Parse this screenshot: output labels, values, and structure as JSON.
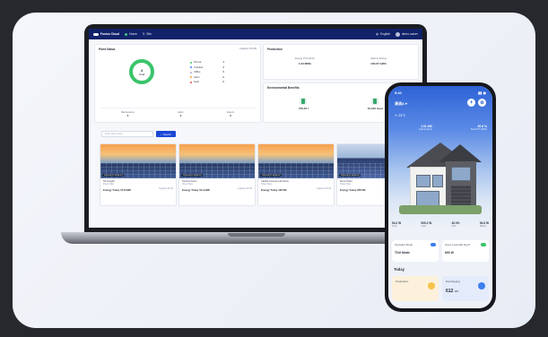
{
  "web": {
    "app_name": "Fusion Cloud",
    "nav": [
      "Home",
      "Site"
    ],
    "lang": "English",
    "user": "demo.owner",
    "plant_status": {
      "title": "Plant Status",
      "capacity": "Capacity: 80 kW",
      "ring_count": "4",
      "ring_label": "Total",
      "legend": [
        {
          "label": "Normal",
          "value": "4",
          "color": "#39c46b"
        },
        {
          "label": "Unlinked",
          "value": "0",
          "color": "#3d7ef0"
        },
        {
          "label": "Offline",
          "value": "0",
          "color": "#a8b0c0"
        },
        {
          "label": "Alarm",
          "value": "0",
          "color": "#f0a030"
        },
        {
          "label": "Fault",
          "value": "0",
          "color": "#e04a4a"
        }
      ],
      "stats": [
        {
          "label": "Maintenance",
          "value": "0"
        },
        {
          "label": "Alarm",
          "value": "0"
        },
        {
          "label": "Events",
          "value": "0"
        }
      ]
    },
    "production": {
      "title": "Production",
      "items": [
        {
          "label": "Energy This Month",
          "value": "1.03 MWh"
        },
        {
          "label": "Lifetime Energy",
          "value": "100.07 GWh"
        }
      ]
    },
    "env": {
      "title": "Environmental Benefits",
      "items": [
        {
          "value": "753.25 t"
        },
        {
          "value": "10,162 trees"
        }
      ]
    },
    "search_placeholder": "Enter plant name",
    "search_btn": "Search",
    "tiles": [
      {
        "badge": "2024-08-27 08:49:20",
        "name": "SK Sungkil",
        "row": "Power Rate",
        "energy": "Energy Today 15.8 kWh",
        "cap": "Capacity 20 kW",
        "img": "a"
      },
      {
        "badge": "2024-08-27 08:49:20",
        "name": "Sunrise Demo",
        "row": "Power Rate",
        "energy": "Energy Today 16.0 kWh",
        "cap": "Capacity 20 kW",
        "img": "a"
      },
      {
        "badge": "2024-08-27 08:49:20",
        "name": "Capital Cosmos Lab Demo",
        "row": "Power Rate",
        "energy": "Energy Today 136 Wh",
        "cap": "Capacity 20 kW",
        "img": "a"
      },
      {
        "badge": "2024-08-27 08:49:20",
        "name": "Demo Plant",
        "row": "Power Rate",
        "energy": "Energy Today 258 Wh",
        "cap": "",
        "img": "b"
      }
    ]
  },
  "phone": {
    "time": "9:41",
    "signal": "▮▮ ◉",
    "site": "清流A ▾",
    "weather": "☀ 23°C",
    "flow_left": {
      "value": "1.01 kW",
      "label": "Grid (Import)"
    },
    "flow_right": {
      "value": "40.6 %",
      "label": "Smart PV (Batt)"
    },
    "stats": [
      {
        "value": "54.2 W",
        "label": "Solar"
      },
      {
        "value": "905.2 W",
        "label": "Load"
      },
      {
        "value": "40.0%",
        "label": "SOC"
      },
      {
        "value": "54.5 W",
        "label": "Battery"
      }
    ],
    "card1": {
      "label": "Operation Mode",
      "value": "TOU Mode"
    },
    "card2": {
      "label": "Home Load with big M",
      "value": "600 W"
    },
    "today": "Today",
    "bottom": [
      {
        "label": "Production",
        "value": ""
      },
      {
        "label": "Discharging",
        "value": "612"
      }
    ],
    "bottom_unit": "Wh"
  }
}
